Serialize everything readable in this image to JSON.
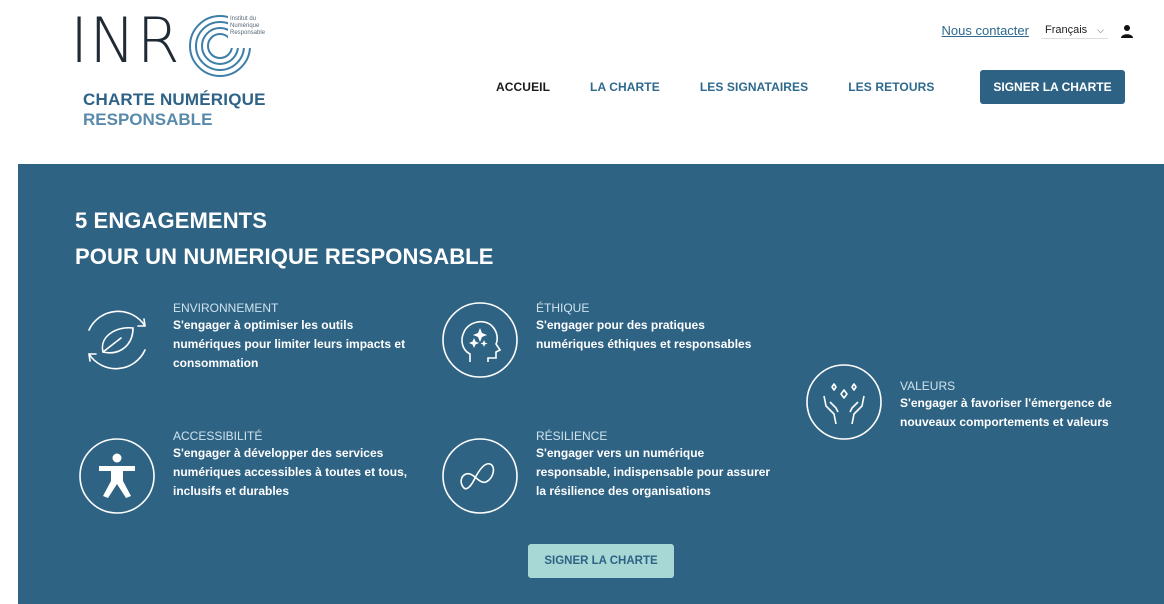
{
  "header": {
    "logo": {
      "letters": "INR",
      "small_lines": [
        "Institut du",
        "Numérique",
        "Responsable"
      ],
      "title": "CHARTE NUMÉRIQUE",
      "subtitle": "RESPONSABLE"
    },
    "contact_label": "Nous contacter",
    "language": "Français",
    "nav": [
      {
        "label": "ACCUEIL"
      },
      {
        "label": "LA CHARTE"
      },
      {
        "label": "LES SIGNATAIRES"
      },
      {
        "label": "LES RETOURS"
      }
    ],
    "cta_label": "SIGNER LA CHARTE"
  },
  "hero": {
    "title_line1": "5 ENGAGEMENTS",
    "title_line2": "POUR UN NUMERIQUE RESPONSABLE",
    "engagements": [
      {
        "label": "ENVIRONNEMENT",
        "desc": "S'engager à optimiser les outils numériques pour limiter leurs impacts et consommation",
        "icon": "leaf-cycle-icon"
      },
      {
        "label": "ÉTHIQUE",
        "desc": "S'engager pour des pratiques numériques éthiques et responsables",
        "icon": "head-sparkle-icon"
      },
      {
        "label": "VALEURS",
        "desc": "S'engager à favoriser l'émergence de nouveaux comportements et valeurs",
        "icon": "hands-stars-icon"
      },
      {
        "label": "ACCESSIBILITÉ",
        "desc": "S'engager à développer des services numériques accessibles à toutes et tous, inclusifs et durables",
        "icon": "accessibility-icon"
      },
      {
        "label": "RÉSILIENCE",
        "desc": "S'engager vers un numérique responsable, indispensable pour assurer la résilience des organisations",
        "icon": "infinity-loop-icon"
      }
    ],
    "cta_label": "SIGNER LA CHARTE"
  },
  "colors": {
    "primary": "#2f6384",
    "accent": "#a7d8d5",
    "nav_text": "#2e6a8e"
  }
}
